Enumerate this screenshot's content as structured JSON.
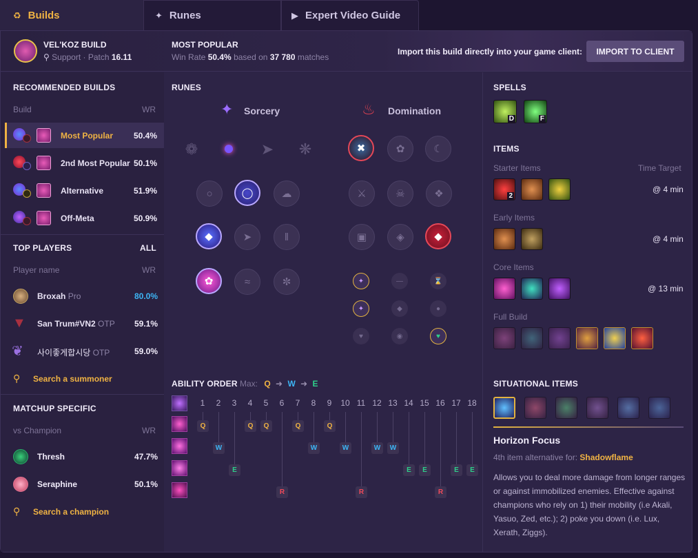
{
  "tabs": [
    {
      "label": "Builds",
      "icon": "helmet-icon"
    },
    {
      "label": "Runes",
      "icon": "rune-icon"
    },
    {
      "label": "Expert Video Guide",
      "icon": "video-icon"
    }
  ],
  "champion": {
    "build_title": "VEL'KOZ BUILD",
    "role": "Support",
    "patch_label": "Patch",
    "patch": "16.11"
  },
  "popular": {
    "title": "MOST POPULAR",
    "win_label": "Win Rate",
    "win_rate": "50.4%",
    "based_on": "based on",
    "matches": "37 780",
    "matches_label": "matches"
  },
  "import": {
    "prompt": "Import this build directly into your game client:",
    "button": "IMPORT TO CLIENT"
  },
  "recommended": {
    "title": "RECOMMENDED BUILDS",
    "col_build": "Build",
    "col_wr": "WR",
    "items": [
      {
        "label": "Most Popular",
        "wr": "50.4%"
      },
      {
        "label": "2nd Most Popular",
        "wr": "50.1%"
      },
      {
        "label": "Alternative",
        "wr": "51.9%"
      },
      {
        "label": "Off-Meta",
        "wr": "50.9%"
      }
    ]
  },
  "top_players": {
    "title": "TOP PLAYERS",
    "all": "ALL",
    "col_name": "Player name",
    "col_wr": "WR",
    "players": [
      {
        "name": "Broxah",
        "tag": "Pro",
        "wr": "80.0%"
      },
      {
        "name": "San Trum#VN2",
        "tag": "OTP",
        "wr": "59.1%"
      },
      {
        "name": "사이좋게합시당",
        "tag": "OTP",
        "wr": "59.0%"
      }
    ],
    "search": "Search a summoner"
  },
  "matchup": {
    "title": "MATCHUP SPECIFIC",
    "col_name": "vs Champion",
    "col_wr": "WR",
    "champs": [
      {
        "name": "Thresh",
        "wr": "47.7%"
      },
      {
        "name": "Seraphine",
        "wr": "50.1%"
      }
    ],
    "search": "Search a champion"
  },
  "runes": {
    "title": "RUNES",
    "primary": "Sorcery",
    "secondary": "Domination"
  },
  "ability": {
    "title": "ABILITY ORDER",
    "max_label": "Max:",
    "max": [
      "Q",
      "W",
      "E"
    ],
    "levels": [
      "1",
      "2",
      "3",
      "4",
      "5",
      "6",
      "7",
      "8",
      "9",
      "10",
      "11",
      "12",
      "13",
      "14",
      "15",
      "16",
      "17",
      "18"
    ],
    "keys": {
      "q": "Q",
      "w": "W",
      "e": "E",
      "r": "R"
    }
  },
  "spells": {
    "title": "SPELLS",
    "keys": [
      "D",
      "F"
    ]
  },
  "items": {
    "title": "ITEMS",
    "time_target": "Time Target",
    "starter": {
      "label": "Starter Items",
      "time": "@ 4 min",
      "count": "2"
    },
    "early": {
      "label": "Early Items",
      "time": "@ 4 min"
    },
    "core": {
      "label": "Core Items",
      "time": "@ 13 min"
    },
    "full": {
      "label": "Full Build"
    }
  },
  "situational": {
    "title": "SITUATIONAL ITEMS",
    "item_name": "Horizon Focus",
    "alt_prefix": "4th item alternative for:",
    "alt_item": "Shadowflame",
    "description": "Allows you to deal more damage from longer ranges or against immobilized enemies. Effective against champions who rely on 1) their mobility (i.e Akali, Yasuo, Zed, etc.); 2) poke you down (i.e. Lux, Xerath, Ziggs)."
  },
  "colors": {
    "accent": "#f0b343",
    "q": "#f0b343",
    "w": "#3db5f5",
    "e": "#2ecf8a",
    "r": "#f04a5a",
    "link": "#3db5f5"
  }
}
